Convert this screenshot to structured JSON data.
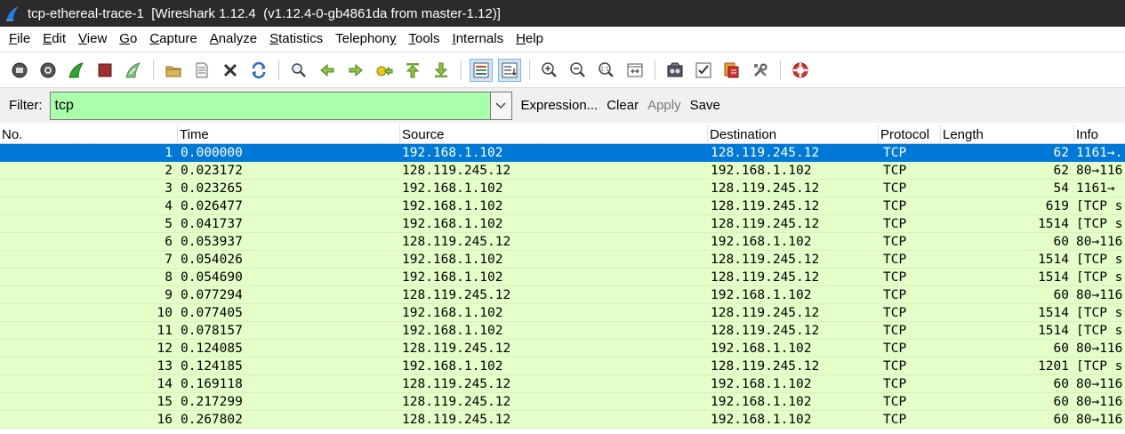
{
  "window": {
    "title": "tcp-ethereal-trace-1  [Wireshark 1.12.4  (v1.12.4-0-gb4861da from master-1.12)]"
  },
  "menu": [
    {
      "key": "F",
      "rest": "ile"
    },
    {
      "key": "E",
      "rest": "dit"
    },
    {
      "key": "V",
      "rest": "iew"
    },
    {
      "key": "G",
      "rest": "o"
    },
    {
      "key": "C",
      "rest": "apture"
    },
    {
      "key": "A",
      "rest": "nalyze"
    },
    {
      "key": "S",
      "rest": "tatistics"
    },
    {
      "key": "",
      "rest": "Telephon",
      "key2": "y"
    },
    {
      "key": "T",
      "rest": "ools"
    },
    {
      "key": "I",
      "rest": "nternals"
    },
    {
      "key": "H",
      "rest": "elp"
    }
  ],
  "filter": {
    "label": "Filter:",
    "value": "tcp",
    "expression": "Expression...",
    "clear": "Clear",
    "apply": "Apply",
    "save": "Save"
  },
  "columns": {
    "no": "No.",
    "time": "Time",
    "source": "Source",
    "destination": "Destination",
    "protocol": "Protocol",
    "length": "Length",
    "info": "Info"
  },
  "packets": [
    {
      "no": "1",
      "time": "0.000000",
      "src": "192.168.1.102",
      "dst": "128.119.245.12",
      "proto": "TCP",
      "len": "62",
      "info": "1161→..."
    },
    {
      "no": "2",
      "time": "0.023172",
      "src": "128.119.245.12",
      "dst": "192.168.1.102",
      "proto": "TCP",
      "len": "62",
      "info": "80→116"
    },
    {
      "no": "3",
      "time": "0.023265",
      "src": "192.168.1.102",
      "dst": "128.119.245.12",
      "proto": "TCP",
      "len": "54",
      "info": "1161→"
    },
    {
      "no": "4",
      "time": "0.026477",
      "src": "192.168.1.102",
      "dst": "128.119.245.12",
      "proto": "TCP",
      "len": "619",
      "info": "[TCP s"
    },
    {
      "no": "5",
      "time": "0.041737",
      "src": "192.168.1.102",
      "dst": "128.119.245.12",
      "proto": "TCP",
      "len": "1514",
      "info": "[TCP s"
    },
    {
      "no": "6",
      "time": "0.053937",
      "src": "128.119.245.12",
      "dst": "192.168.1.102",
      "proto": "TCP",
      "len": "60",
      "info": "80→116"
    },
    {
      "no": "7",
      "time": "0.054026",
      "src": "192.168.1.102",
      "dst": "128.119.245.12",
      "proto": "TCP",
      "len": "1514",
      "info": "[TCP s"
    },
    {
      "no": "8",
      "time": "0.054690",
      "src": "192.168.1.102",
      "dst": "128.119.245.12",
      "proto": "TCP",
      "len": "1514",
      "info": "[TCP s"
    },
    {
      "no": "9",
      "time": "0.077294",
      "src": "128.119.245.12",
      "dst": "192.168.1.102",
      "proto": "TCP",
      "len": "60",
      "info": "80→116"
    },
    {
      "no": "10",
      "time": "0.077405",
      "src": "192.168.1.102",
      "dst": "128.119.245.12",
      "proto": "TCP",
      "len": "1514",
      "info": "[TCP s"
    },
    {
      "no": "11",
      "time": "0.078157",
      "src": "192.168.1.102",
      "dst": "128.119.245.12",
      "proto": "TCP",
      "len": "1514",
      "info": "[TCP s"
    },
    {
      "no": "12",
      "time": "0.124085",
      "src": "128.119.245.12",
      "dst": "192.168.1.102",
      "proto": "TCP",
      "len": "60",
      "info": "80→116"
    },
    {
      "no": "13",
      "time": "0.124185",
      "src": "192.168.1.102",
      "dst": "128.119.245.12",
      "proto": "TCP",
      "len": "1201",
      "info": "[TCP s"
    },
    {
      "no": "14",
      "time": "0.169118",
      "src": "128.119.245.12",
      "dst": "192.168.1.102",
      "proto": "TCP",
      "len": "60",
      "info": "80→116"
    },
    {
      "no": "15",
      "time": "0.217299",
      "src": "128.119.245.12",
      "dst": "192.168.1.102",
      "proto": "TCP",
      "len": "60",
      "info": "80→116"
    },
    {
      "no": "16",
      "time": "0.267802",
      "src": "128.119.245.12",
      "dst": "192.168.1.102",
      "proto": "TCP",
      "len": "60",
      "info": "80→116"
    }
  ],
  "colors": {
    "titlebar": "#2b2b2b",
    "row_tcp": "#e4ffc7",
    "row_selected": "#0078d7",
    "filter_valid": "#aaffaa"
  }
}
